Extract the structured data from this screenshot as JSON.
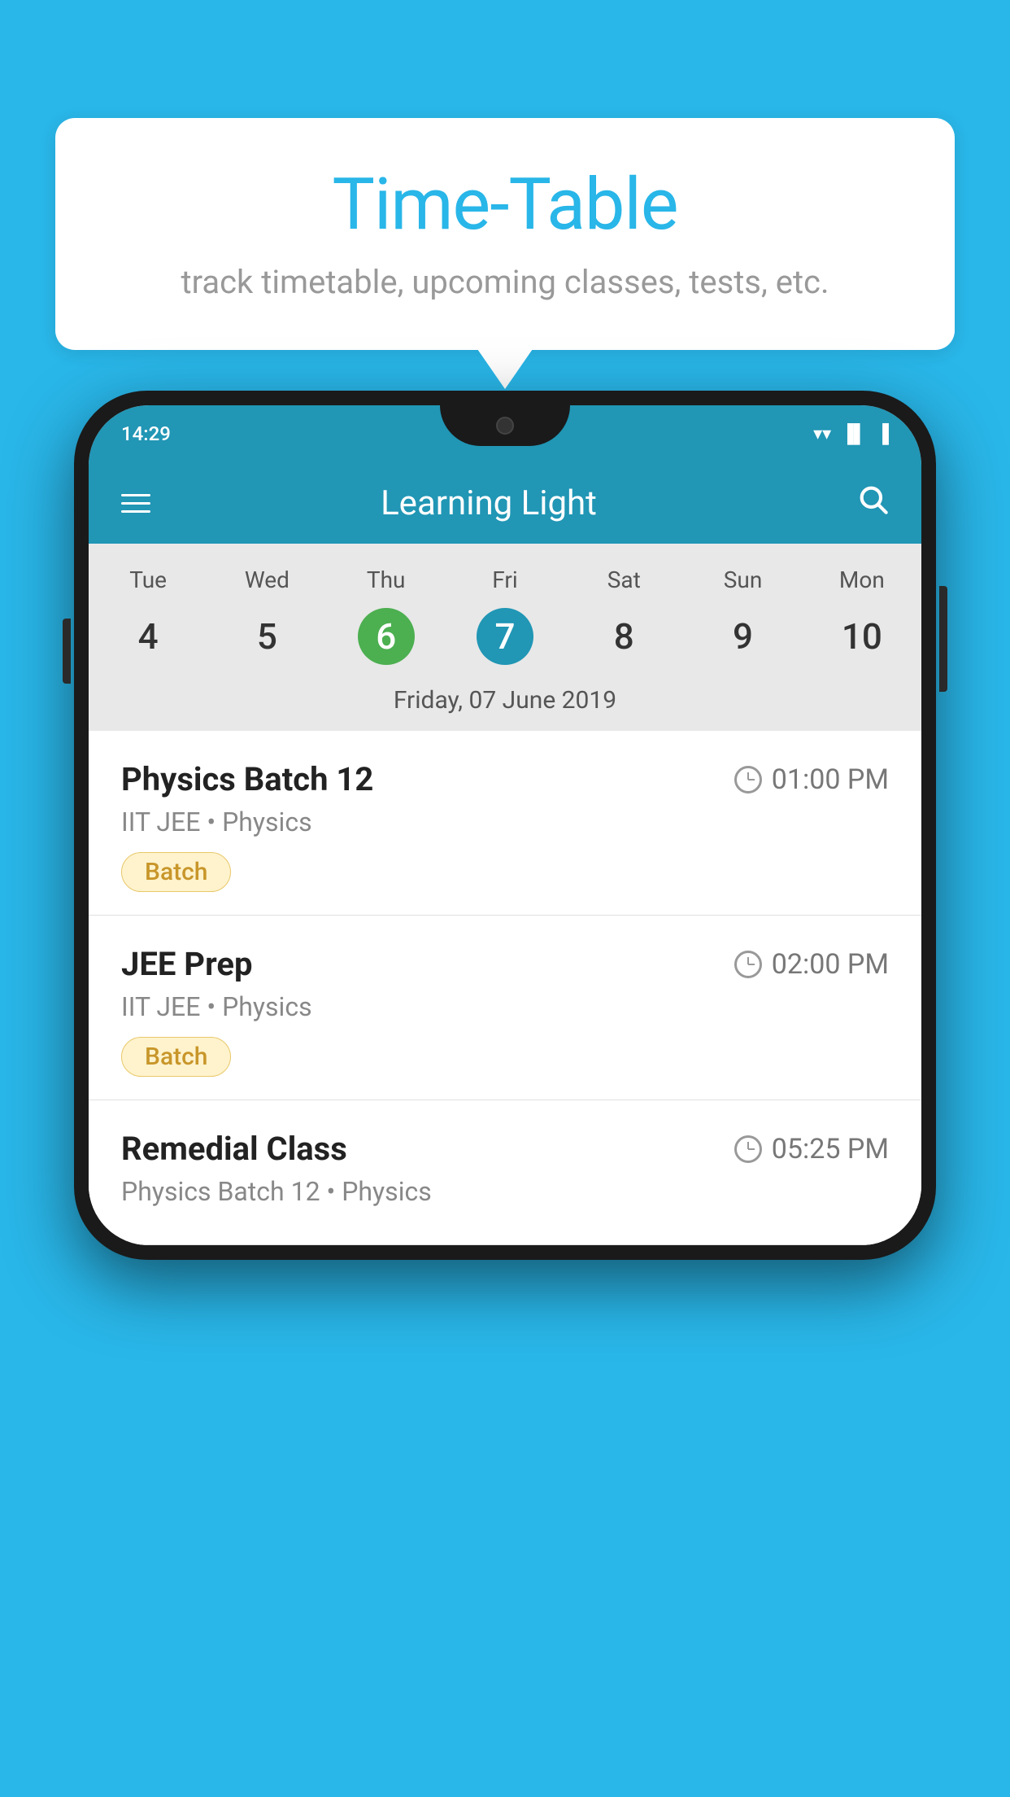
{
  "background_color": "#29b6e8",
  "speech_bubble": {
    "title": "Time-Table",
    "subtitle": "track timetable, upcoming classes, tests, etc."
  },
  "status_bar": {
    "time": "14:29",
    "wifi_icon": "▼",
    "signal_icon": "▲",
    "battery_icon": "▐"
  },
  "app_bar": {
    "title": "Learning Light",
    "menu_icon": "menu",
    "search_icon": "search"
  },
  "calendar": {
    "days": [
      {
        "label": "Tue",
        "num": "4"
      },
      {
        "label": "Wed",
        "num": "5"
      },
      {
        "label": "Thu",
        "num": "6",
        "state": "today"
      },
      {
        "label": "Fri",
        "num": "7",
        "state": "selected"
      },
      {
        "label": "Sat",
        "num": "8"
      },
      {
        "label": "Sun",
        "num": "9"
      },
      {
        "label": "Mon",
        "num": "10"
      }
    ],
    "selected_date_label": "Friday, 07 June 2019"
  },
  "schedule_items": [
    {
      "id": 1,
      "title": "Physics Batch 12",
      "time": "01:00 PM",
      "subtitle": "IIT JEE • Physics",
      "badge": "Batch"
    },
    {
      "id": 2,
      "title": "JEE Prep",
      "time": "02:00 PM",
      "subtitle": "IIT JEE • Physics",
      "badge": "Batch"
    },
    {
      "id": 3,
      "title": "Remedial Class",
      "time": "05:25 PM",
      "subtitle": "Physics Batch 12 • Physics",
      "badge": null
    }
  ]
}
